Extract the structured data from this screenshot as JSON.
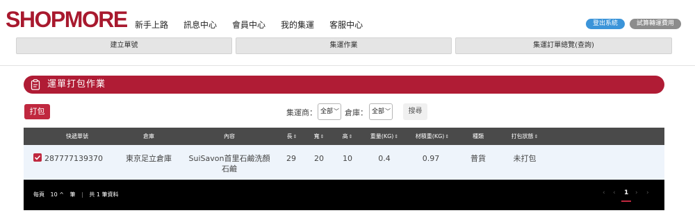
{
  "header": {
    "logo": "SHOPMORE",
    "nav": [
      "新手上路",
      "訊息中心",
      "會員中心",
      "我的集運",
      "客服中心"
    ],
    "logout_label": "登出系統",
    "fee_label": "試算轉運費用"
  },
  "tabs": [
    "建立單號",
    "集運作業",
    "集運訂單總覽(查詢)"
  ],
  "section": {
    "title": "運單打包作業"
  },
  "toolbar": {
    "pack_label": "打包",
    "carrier_label": "集運商：",
    "carrier_value": "全部",
    "warehouse_label": "倉庫：",
    "warehouse_value": "全部",
    "search_label": "搜尋"
  },
  "table": {
    "columns": [
      "快遞單號",
      "倉庫",
      "內容",
      "長",
      "寬",
      "高",
      "重量(KG)",
      "材積重(KG)",
      "種類",
      "打包狀態"
    ],
    "rows": [
      {
        "tracking": "287777139370",
        "warehouse": "東京足立倉庫",
        "content_line1": "SuiSavon首里石鹼洗顏",
        "content_line2": "石鹼",
        "length": "29",
        "width": "20",
        "height": "10",
        "weight": "0.4",
        "volume_weight": "0.97",
        "type": "普貨",
        "status": "未打包",
        "checked": true
      }
    ]
  },
  "footer": {
    "per_page_prefix": "每頁",
    "per_page_value": "10",
    "per_page_suffix": "筆",
    "total": "共 1 筆資料",
    "current_page": "1"
  },
  "colors": {
    "brand": "#a8192e",
    "accent": "#c0283f",
    "logout": "#3b94d9"
  }
}
